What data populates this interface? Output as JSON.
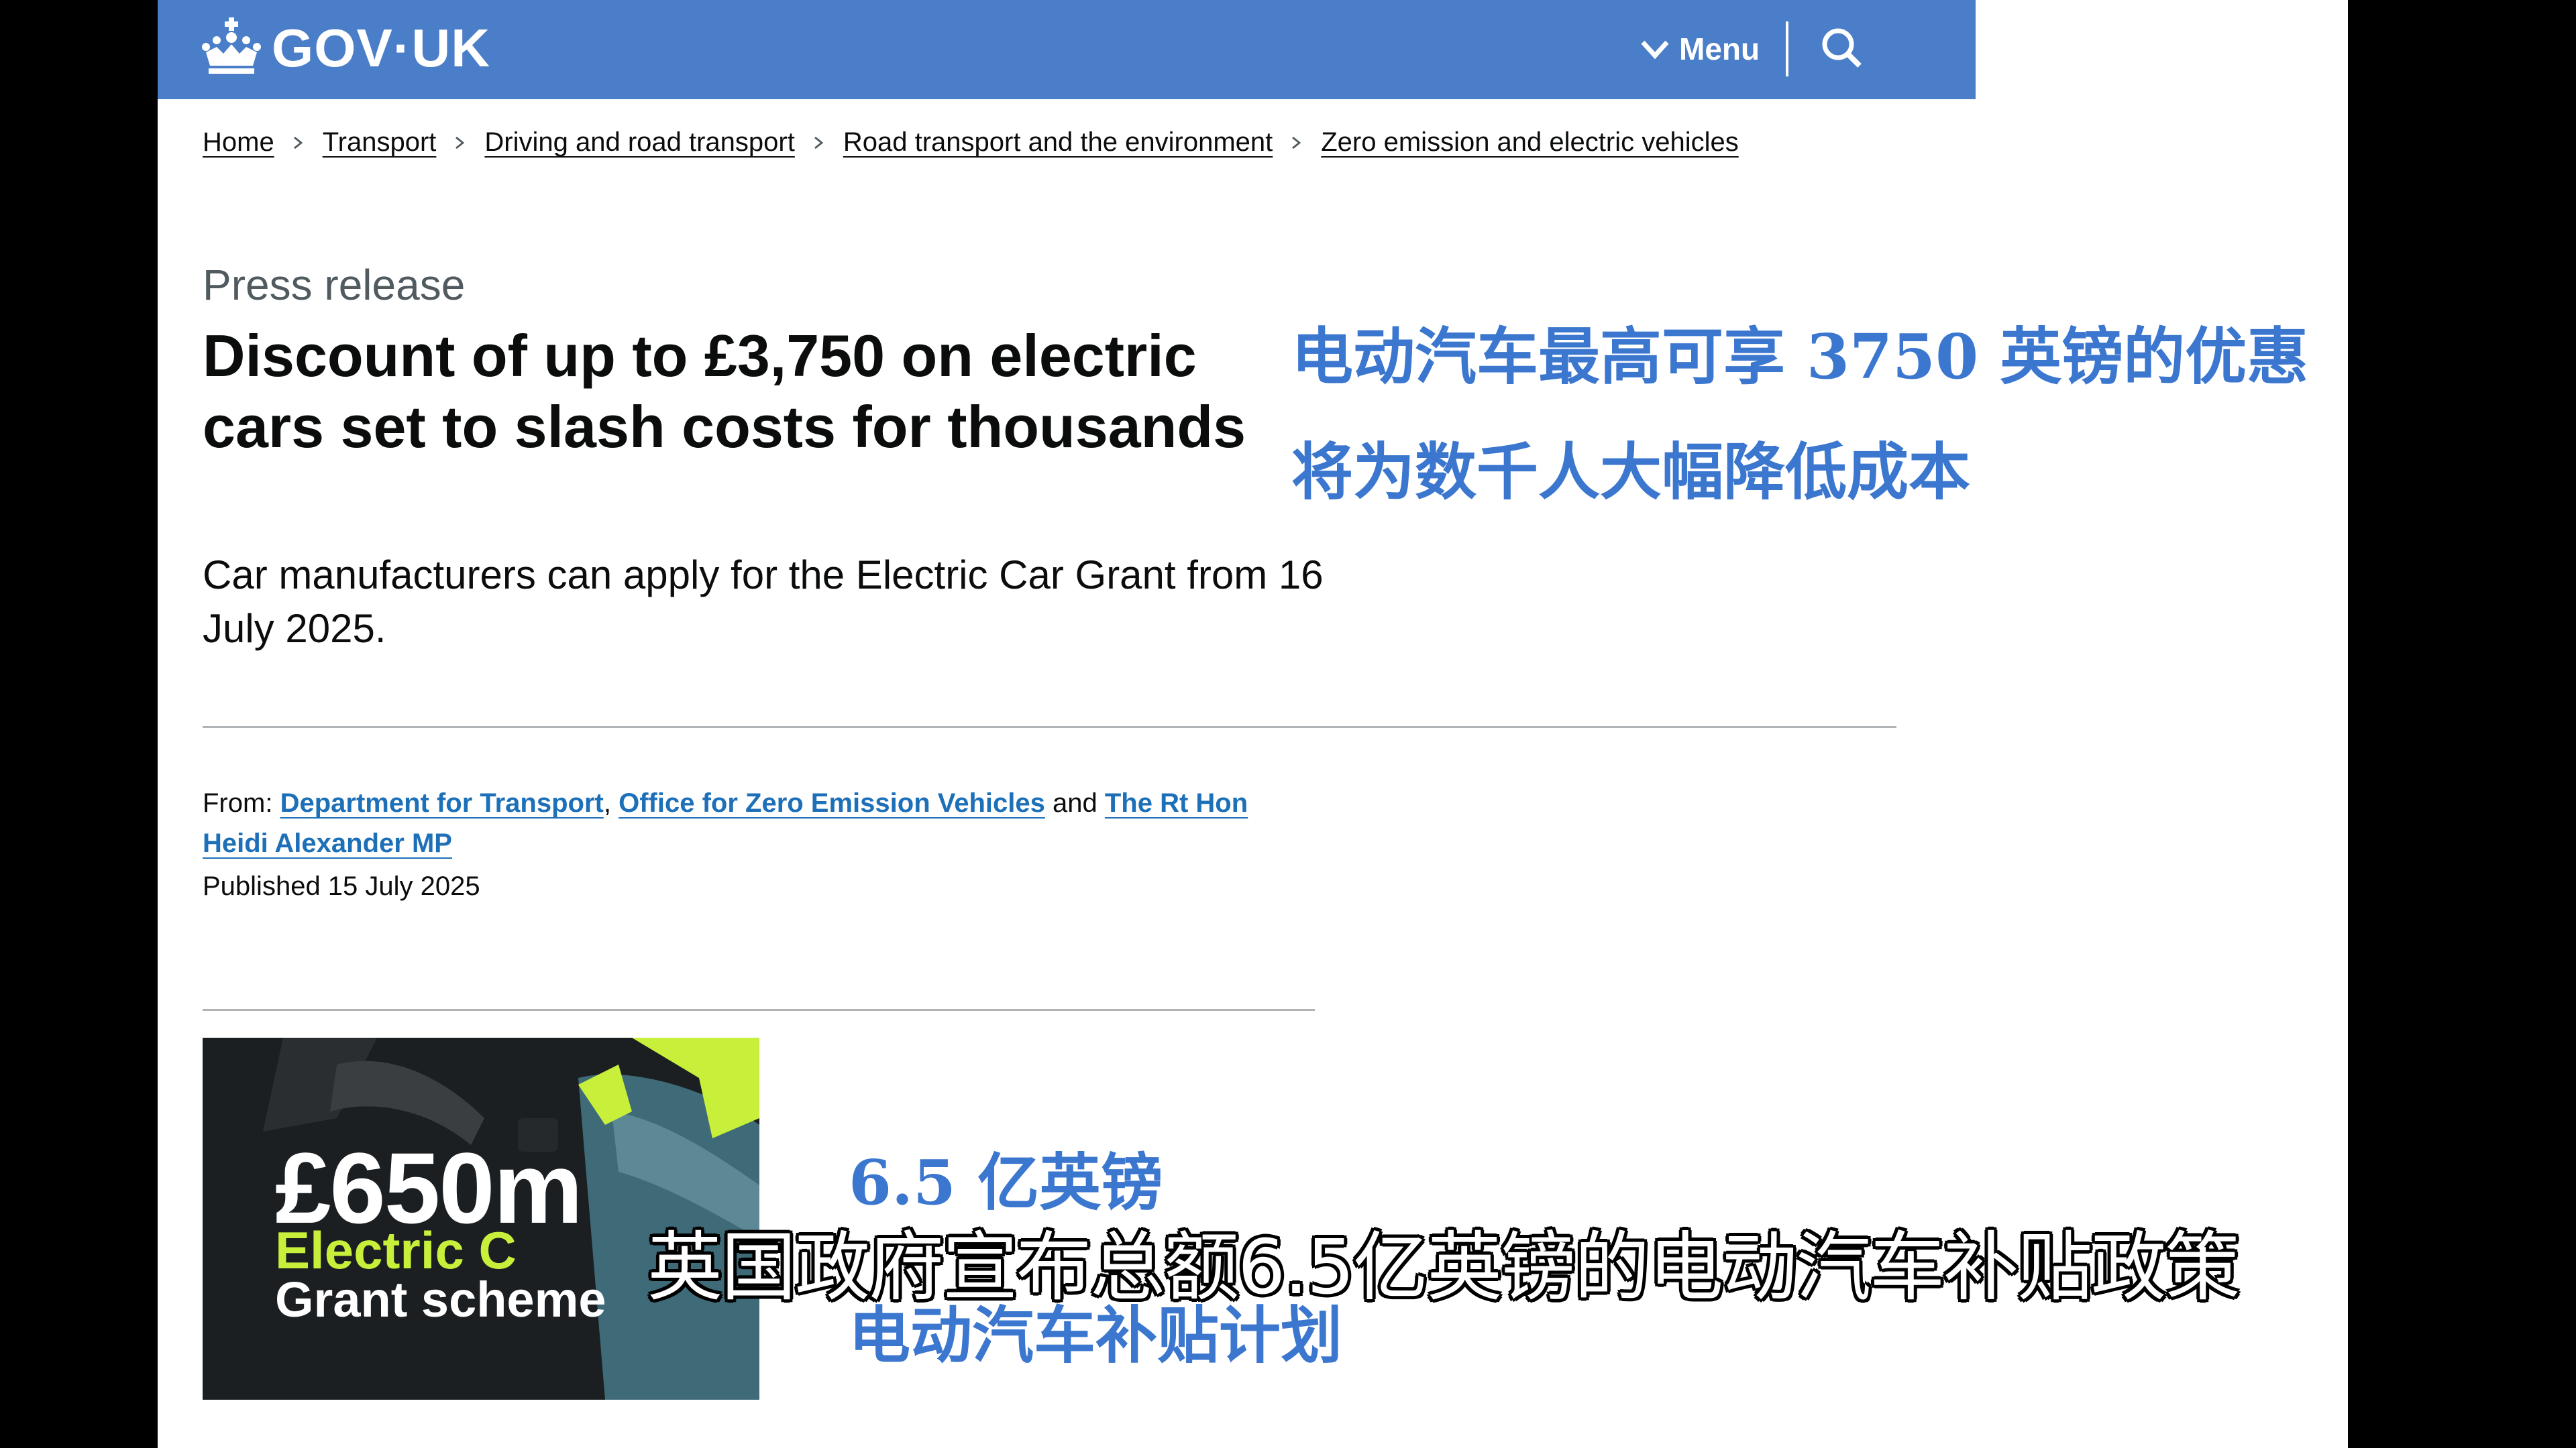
{
  "header": {
    "logo_text": "GOV·UK",
    "menu_label": "Menu",
    "icons": {
      "logo": "crown-icon",
      "menu": "chevron-down-icon",
      "search": "search-icon"
    },
    "brand_color": "#4b7ec8"
  },
  "breadcrumb": [
    "Home",
    "Transport",
    "Driving and road transport",
    "Road transport and the environment",
    "Zero emission and electric vehicles"
  ],
  "article": {
    "caption": "Press release",
    "title": "Discount of up to £3,750 on electric cars set to slash costs for thousands",
    "lead": "Car manufacturers can apply for the Electric Car Grant from 16 July 2025.",
    "from_label": "From:",
    "from_org_1": "Department for Transport",
    "from_sep": ",",
    "from_org_2": "Office for Zero Emission Vehicles",
    "from_and": "and",
    "from_person": "The Rt Hon Heidi Alexander MP",
    "published": "Published 15 July 2025",
    "link_color": "#1d70b8"
  },
  "hero_image": {
    "amount": "£650m",
    "line1": "Electric C",
    "line2": "Grant scheme",
    "accent_color": "#c8f03a"
  },
  "overlays": {
    "title_cn_1": "电动汽车最高可享 3750 英镑的优惠",
    "title_cn_2": "将为数千人大幅降低成本",
    "sub_cn_1": "6.5 亿英镑",
    "sub_cn_2": "电动汽车补贴计划",
    "subtitle": "英国政府宣布总额6.5亿英镑的电动汽车补贴政策",
    "overlay_color": "#3b76cf"
  }
}
